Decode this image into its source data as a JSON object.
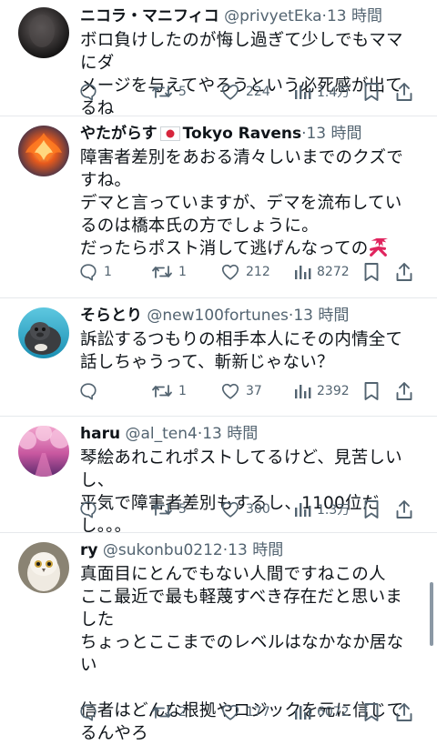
{
  "tweets": [
    {
      "name": "ニコラ・マニフィコ",
      "handle": "@privyetEka",
      "time": "13 時間",
      "lines": [
        "ボロ負けしたのが悔し過ぎて少しでもママにダ",
        "メージを与えてやろうという必死感が出てるね"
      ],
      "reply_count": "",
      "retweet_count": "5",
      "like_count": "224",
      "view_count": "1.4万",
      "avatar": "dark-blurred-photo"
    },
    {
      "name": "やたがらす",
      "handle": "Tokyo Ravens",
      "time": "13 時間",
      "lines": [
        "障害者差別をあおる清々しいまでのクズですね。",
        "デマと言っていますが、デマを流布しているのは橋本氏の方でしょうに。",
        "だったらポスト消して逃げんなっての"
      ],
      "reply_count": "1",
      "retweet_count": "1",
      "like_count": "212",
      "view_count": "8272",
      "avatar": "phoenix-illustration",
      "flag": "japan-flag",
      "line_emoji": "anger-symbol"
    },
    {
      "name": "そらとり",
      "handle": "@new100fortunes",
      "time": "13 時間",
      "lines": [
        "訴訟するつもりの相手本人にその内情全て話しちゃうって、斬新じゃない？"
      ],
      "reply_count": "",
      "retweet_count": "1",
      "like_count": "37",
      "view_count": "2392",
      "avatar": "seal-photo"
    },
    {
      "name": "haru",
      "handle": "@al_ten4",
      "time": "13 時間",
      "lines": [
        "琴絵あれこれポストしてるけど、見苦しいし、",
        "平気で障害者差別もするし、1100位だし。。。"
      ],
      "reply_count": "",
      "retweet_count": "5",
      "like_count": "300",
      "view_count": "1.3万",
      "avatar": "pink-cherry-blossom-photo"
    },
    {
      "name": "ry",
      "handle": "@sukonbu0212",
      "time": "13 時間",
      "lines": [
        "真面目にとんでもない人間ですねこの人",
        "ここ最近で最も軽蔑すべき存在だと思いました",
        "ちょっとここまでのレベルはなかなか居ない",
        "",
        "信者はどんな根拠やロジックを元に信じてるんやろ"
      ],
      "reply_count": "",
      "retweet_count": "2",
      "like_count": "177",
      "view_count": "6072",
      "avatar": "owl-photo"
    }
  ],
  "colors": {
    "text": "#0f1419",
    "secondary": "#536471",
    "divider": "#e6e9ec",
    "anger": "#e0245e"
  }
}
